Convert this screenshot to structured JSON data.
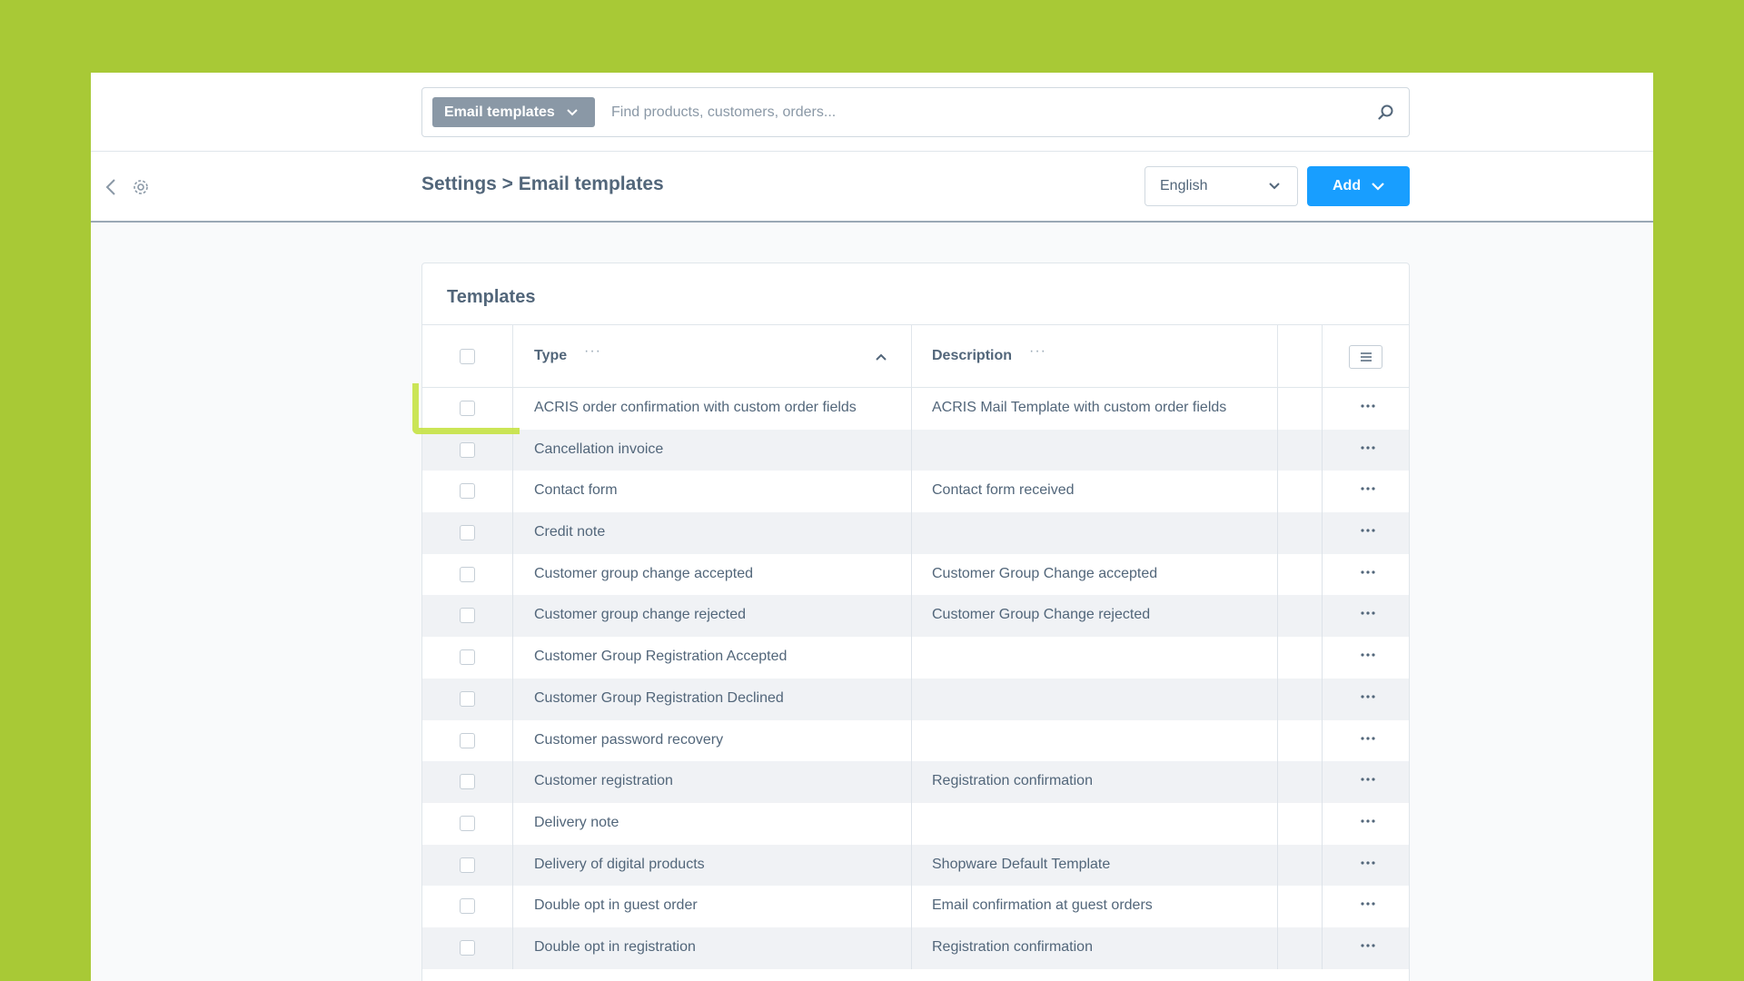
{
  "search": {
    "type_label": "Email templates",
    "placeholder": "Find products, customers, orders..."
  },
  "header": {
    "breadcrumb": "Settings > Email templates",
    "language": "English",
    "add_label": "Add"
  },
  "card": {
    "title": "Templates"
  },
  "grid": {
    "columns": {
      "type": "Type",
      "description": "Description",
      "dots": "···"
    },
    "rows": [
      {
        "type": "ACRIS order confirmation with custom order fields",
        "description": "ACRIS Mail Template with custom order fields"
      },
      {
        "type": "Cancellation invoice",
        "description": ""
      },
      {
        "type": "Contact form",
        "description": "Contact form received"
      },
      {
        "type": "Credit note",
        "description": ""
      },
      {
        "type": "Customer group change accepted",
        "description": "Customer Group Change accepted"
      },
      {
        "type": "Customer group change rejected",
        "description": "Customer Group Change rejected"
      },
      {
        "type": "Customer Group Registration Accepted",
        "description": ""
      },
      {
        "type": "Customer Group Registration Declined",
        "description": ""
      },
      {
        "type": "Customer password recovery",
        "description": ""
      },
      {
        "type": "Customer registration",
        "description": "Registration confirmation"
      },
      {
        "type": "Delivery note",
        "description": ""
      },
      {
        "type": "Delivery of digital products",
        "description": "Shopware Default Template"
      },
      {
        "type": "Double opt in guest order",
        "description": "Email confirmation at guest orders"
      },
      {
        "type": "Double opt in registration",
        "description": "Registration confirmation"
      }
    ]
  },
  "icons": {
    "search": "search-icon",
    "back": "chevron-left-icon",
    "settings": "gear-icon",
    "dropdown": "chevron-down-icon",
    "sort": "chevron-up-icon",
    "row_actions": "ellipsis-icon",
    "grid_settings": "list-icon"
  },
  "colors": {
    "background": "#a8c936",
    "primary": "#189eff",
    "highlight": "#c4e23a"
  }
}
